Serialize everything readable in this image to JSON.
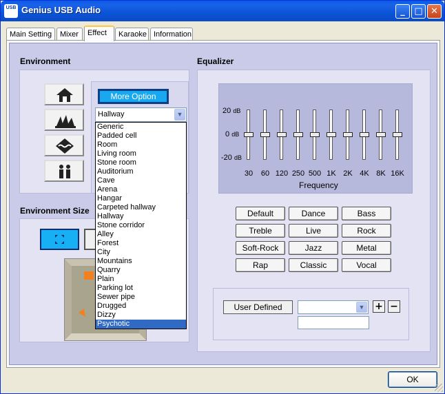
{
  "window": {
    "title": "Genius USB Audio",
    "icon_text": "USB"
  },
  "tabs": [
    {
      "label": "Main Setting"
    },
    {
      "label": "Mixer"
    },
    {
      "label": "Effect",
      "active": true
    },
    {
      "label": "Karaoke"
    },
    {
      "label": "Information"
    }
  ],
  "environment": {
    "title": "Environment",
    "more_option_label": "More Option",
    "selected": "Hallway",
    "options": [
      "Generic",
      "Padded cell",
      "Room",
      "Living room",
      "Stone room",
      "Auditorium",
      "Cave",
      "Arena",
      "Hangar",
      "Carpeted hallway",
      "Hallway",
      "Stone corridor",
      "Alley",
      "Forest",
      "City",
      "Mountains",
      "Quarry",
      "Plain",
      "Parking lot",
      "Sewer pipe",
      "Drugged",
      "Dizzy",
      "Psychotic"
    ],
    "highlighted": "Psychotic",
    "preset_icons": [
      "house-icon",
      "opera-house-icon",
      "water-icon",
      "people-icon"
    ]
  },
  "environment_size": {
    "title": "Environment Size"
  },
  "equalizer": {
    "title": "Equalizer",
    "db_labels": {
      "top": "20",
      "mid": "0",
      "bottom": "-20",
      "unit": "dB"
    },
    "bands": [
      {
        "freq": "30",
        "gain_db": 0
      },
      {
        "freq": "60",
        "gain_db": 0
      },
      {
        "freq": "120",
        "gain_db": 0
      },
      {
        "freq": "250",
        "gain_db": 0
      },
      {
        "freq": "500",
        "gain_db": 0
      },
      {
        "freq": "1K",
        "gain_db": 0
      },
      {
        "freq": "2K",
        "gain_db": 0
      },
      {
        "freq": "4K",
        "gain_db": 0
      },
      {
        "freq": "8K",
        "gain_db": 0
      },
      {
        "freq": "16K",
        "gain_db": 0
      }
    ],
    "frequency_label": "Frequency",
    "presets": [
      [
        "Default",
        "Dance",
        "Bass"
      ],
      [
        "Treble",
        "Live",
        "Rock"
      ],
      [
        "Soft-Rock",
        "Jazz",
        "Metal"
      ],
      [
        "Rap",
        "Classic",
        "Vocal"
      ]
    ],
    "user_defined_label": "User  Defined",
    "user_defined_value": "",
    "user_name_value": ""
  },
  "buttons": {
    "ok": "OK",
    "add": "+",
    "remove": "−",
    "minimize": "_",
    "maximize": "□",
    "close": "✕"
  },
  "colors": {
    "title_bar": "#0a5ae7",
    "panel": "#c9cbe9",
    "highlight": "#316ac5",
    "more_option": "#18a8f0"
  }
}
